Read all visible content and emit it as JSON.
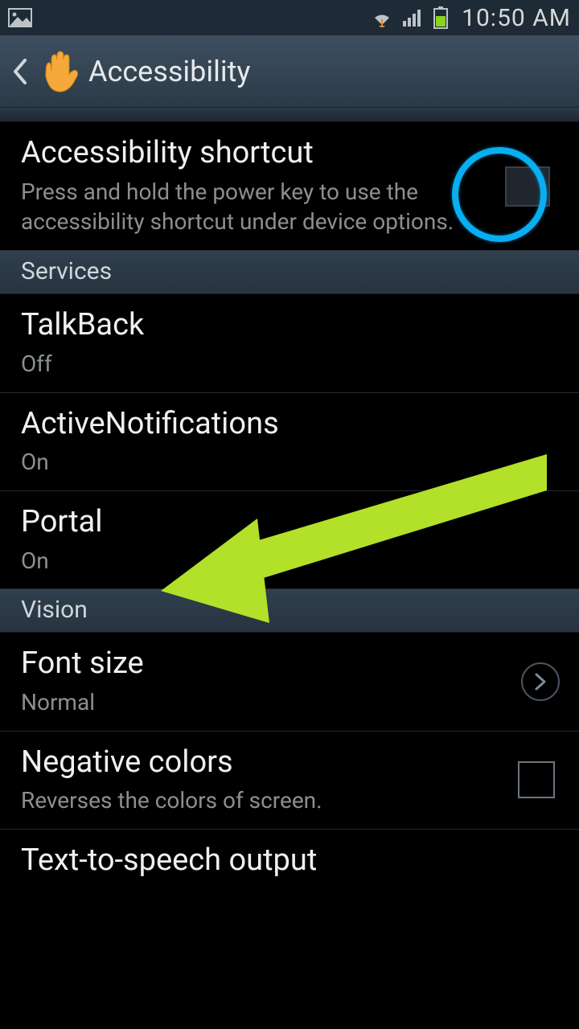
{
  "statusbar": {
    "time": "10:50 AM"
  },
  "header": {
    "title": "Accessibility"
  },
  "items": {
    "accessibility_shortcut": {
      "title": "Accessibility shortcut",
      "subtitle": "Press and hold the power key to use the accessibility shortcut under device options."
    },
    "talkback": {
      "title": "TalkBack",
      "status": "Off"
    },
    "active_notifications": {
      "title": "ActiveNotifications",
      "status": "On"
    },
    "portal": {
      "title": "Portal",
      "status": "On"
    },
    "font_size": {
      "title": "Font size",
      "value": "Normal"
    },
    "negative_colors": {
      "title": "Negative colors",
      "subtitle": "Reverses the colors of screen."
    },
    "tts": {
      "title": "Text-to-speech output"
    }
  },
  "sections": {
    "services": "Services",
    "vision": "Vision"
  }
}
